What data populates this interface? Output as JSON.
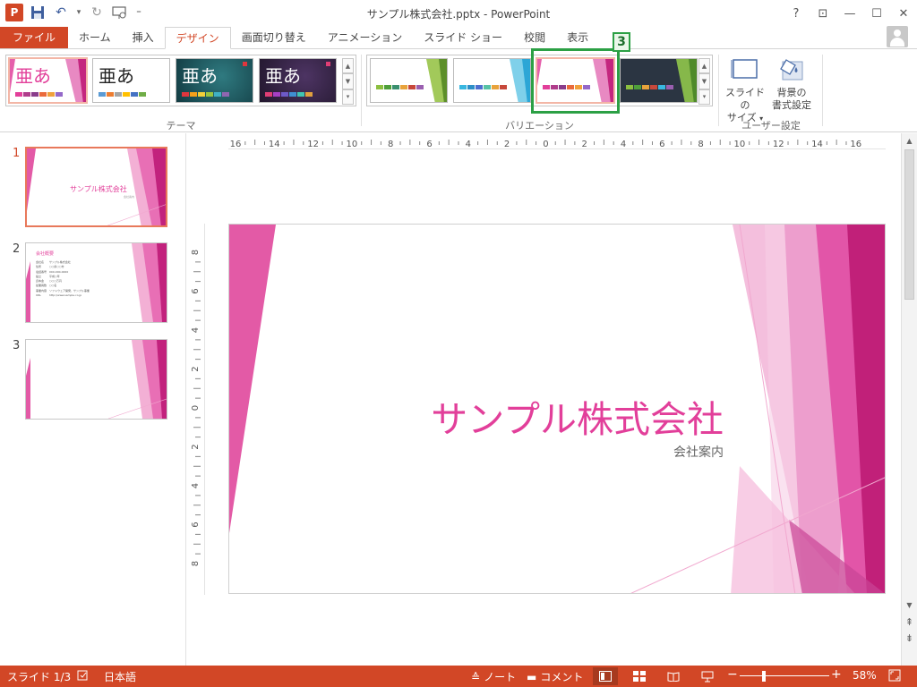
{
  "window": {
    "title": "サンプル株式会社.pptx - PowerPoint",
    "app_logo": "P",
    "help": "?",
    "restore_ribbon": "⊡",
    "minimize": "—",
    "maximize": "☐",
    "close": "✕"
  },
  "qat": {
    "save_icon": "save-icon",
    "undo_icon": "undo-icon",
    "undo_arrow": "↶",
    "undo_dropdown": "▾",
    "redo_icon": "redo-icon",
    "redo_arrow": "↻",
    "present_icon": "presentation-icon",
    "customize": "⁼"
  },
  "ribbon_tabs": [
    {
      "label": "ファイル"
    },
    {
      "label": "ホーム"
    },
    {
      "label": "挿入"
    },
    {
      "label": "デザイン"
    },
    {
      "label": "画面切り替え"
    },
    {
      "label": "アニメーション"
    },
    {
      "label": "スライド ショー"
    },
    {
      "label": "校閲"
    },
    {
      "label": "表示"
    }
  ],
  "active_tab": "デザイン",
  "themes_group": {
    "label": "テーマ",
    "thumbs": [
      {
        "text": "亜あ",
        "style": "pink",
        "selected": true
      },
      {
        "text": "亜あ",
        "style": "office",
        "selected": false
      },
      {
        "text": "亜あ",
        "style": "teal",
        "selected": false
      },
      {
        "text": "亜あ",
        "style": "purple",
        "selected": false
      }
    ]
  },
  "variants_group": {
    "label": "バリエーション",
    "thumbs": [
      {
        "style": "green"
      },
      {
        "style": "blue"
      },
      {
        "style": "pink"
      },
      {
        "style": "dark"
      }
    ]
  },
  "customize_group": {
    "label": "ユーザー設定",
    "slide_size": "スライドの\nサイズ",
    "slide_size_line1": "スライドの",
    "slide_size_line2": "サイズ",
    "slide_size_arrow": "▾",
    "background_line1": "背景の",
    "background_line2": "書式設定"
  },
  "annotation": {
    "step": "3"
  },
  "gallery_scroll": {
    "up": "▲",
    "down": "▼",
    "more": "▾"
  },
  "slides": [
    {
      "number": "1",
      "title": "サンプル株式会社",
      "subtitle": "会社案内",
      "current": true
    },
    {
      "number": "2",
      "title": "会社概要",
      "current": false,
      "lines": [
        "会社名　　サンプル株式会社",
        "住所　　　○○県○○市",
        "電話番号　000-000-0000",
        "設立　　　平成○年",
        "資本金　　○○○万円",
        "従業員数　○○名",
        "事業内容　ソフトウェア開発、サンプル事業",
        "URL　　　http://www.sample.co.jp"
      ]
    },
    {
      "number": "3",
      "current": false
    }
  ],
  "main_slide": {
    "title": "サンプル株式会社",
    "subtitle": "会社案内"
  },
  "ruler": {
    "h_ticks": [
      "16",
      "14",
      "12",
      "10",
      "8",
      "6",
      "4",
      "2",
      "0",
      "2",
      "4",
      "6",
      "8",
      "10",
      "12",
      "14",
      "16"
    ],
    "v_ticks": [
      "8",
      "6",
      "4",
      "2",
      "0",
      "2",
      "4",
      "6",
      "8"
    ]
  },
  "scrollbar": {
    "up": "▲",
    "down": "▼",
    "prev": "⇞",
    "next": "⇟"
  },
  "status": {
    "slide_info": "スライド 1/3",
    "language": "日本語",
    "notes": "ノート",
    "comments": "コメント",
    "zoom_minus": "−",
    "zoom_plus": "+",
    "zoom": "58%",
    "zoom_level": 0.58
  },
  "colors": {
    "accent": "#d24726",
    "theme_pink": "#e23f9a",
    "highlight": "#2ca045"
  }
}
